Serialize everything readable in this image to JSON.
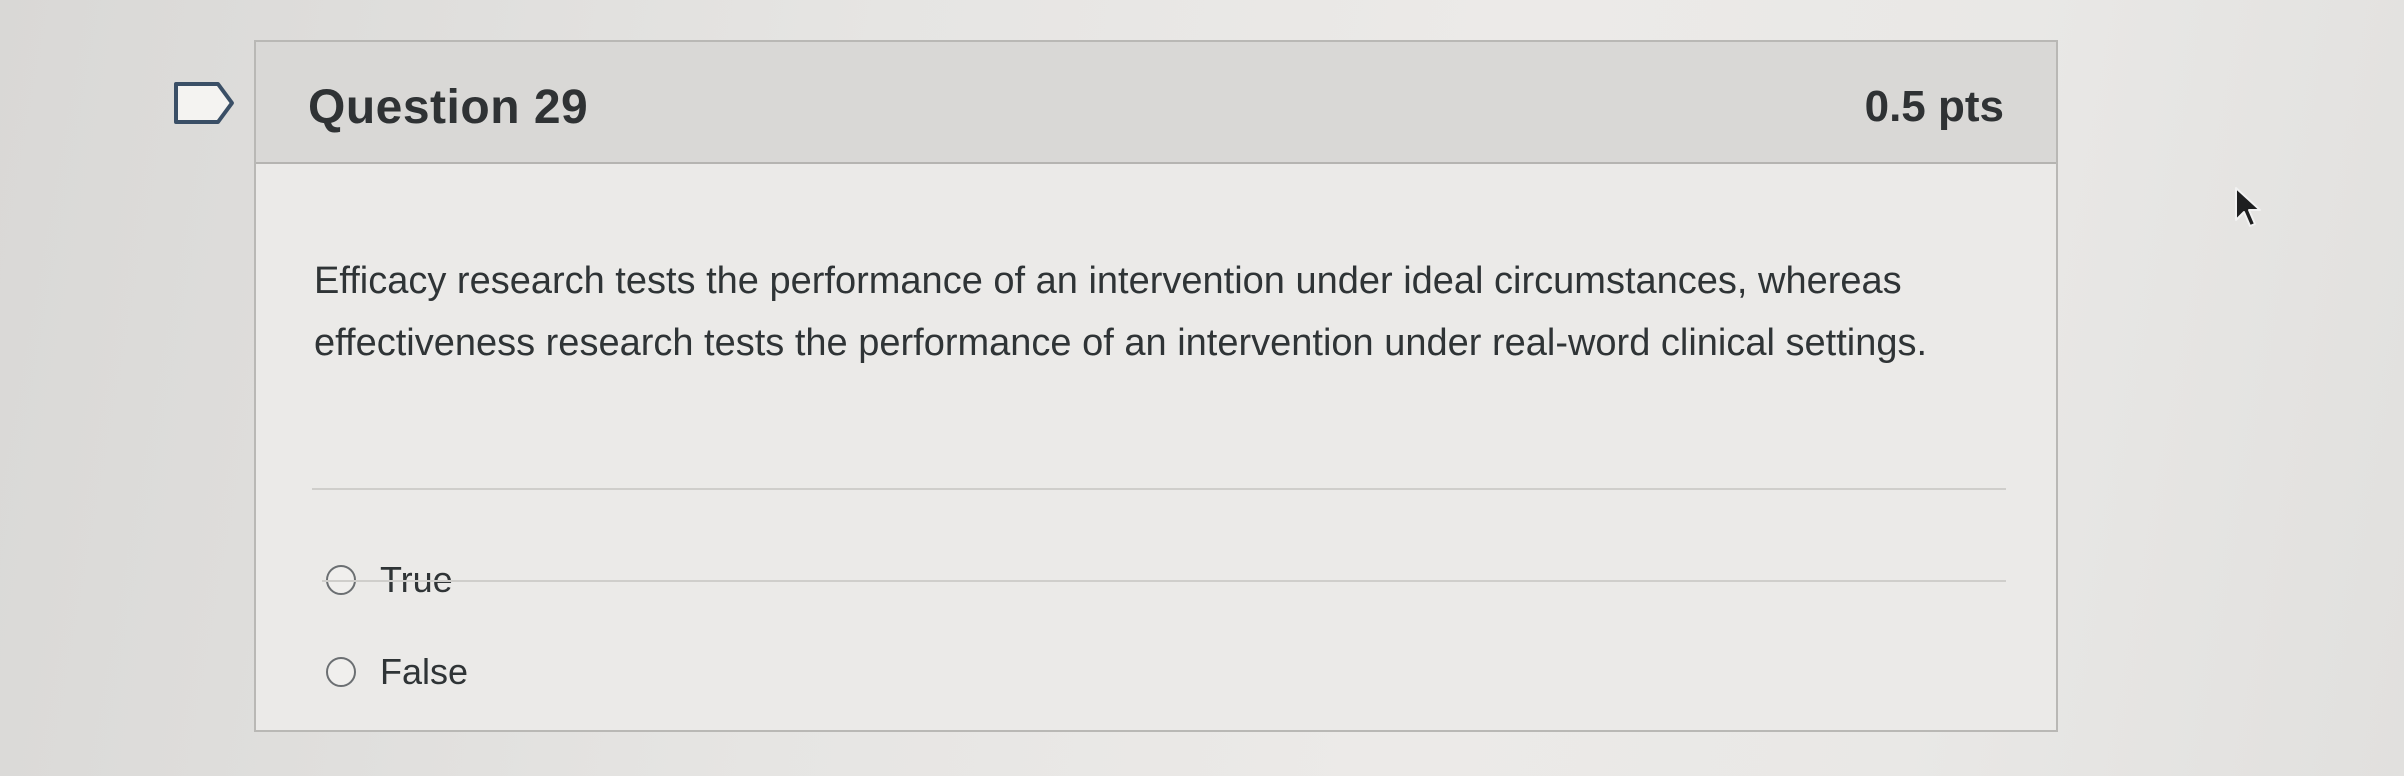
{
  "question": {
    "title": "Question 29",
    "points": "0.5 pts",
    "text": "Efficacy research tests the performance of an intervention under ideal circumstances, whereas effectiveness research tests the performance of an intervention under real-word clinical settings.",
    "answers": [
      {
        "label": "True",
        "selected": false
      },
      {
        "label": "False",
        "selected": false
      }
    ]
  },
  "icons": {
    "flag": "flag-icon",
    "cursor": "mouse-cursor-icon"
  },
  "colors": {
    "header_bg": "#d9d8d6",
    "body_bg": "#ebeae8",
    "text": "#2f3436"
  }
}
